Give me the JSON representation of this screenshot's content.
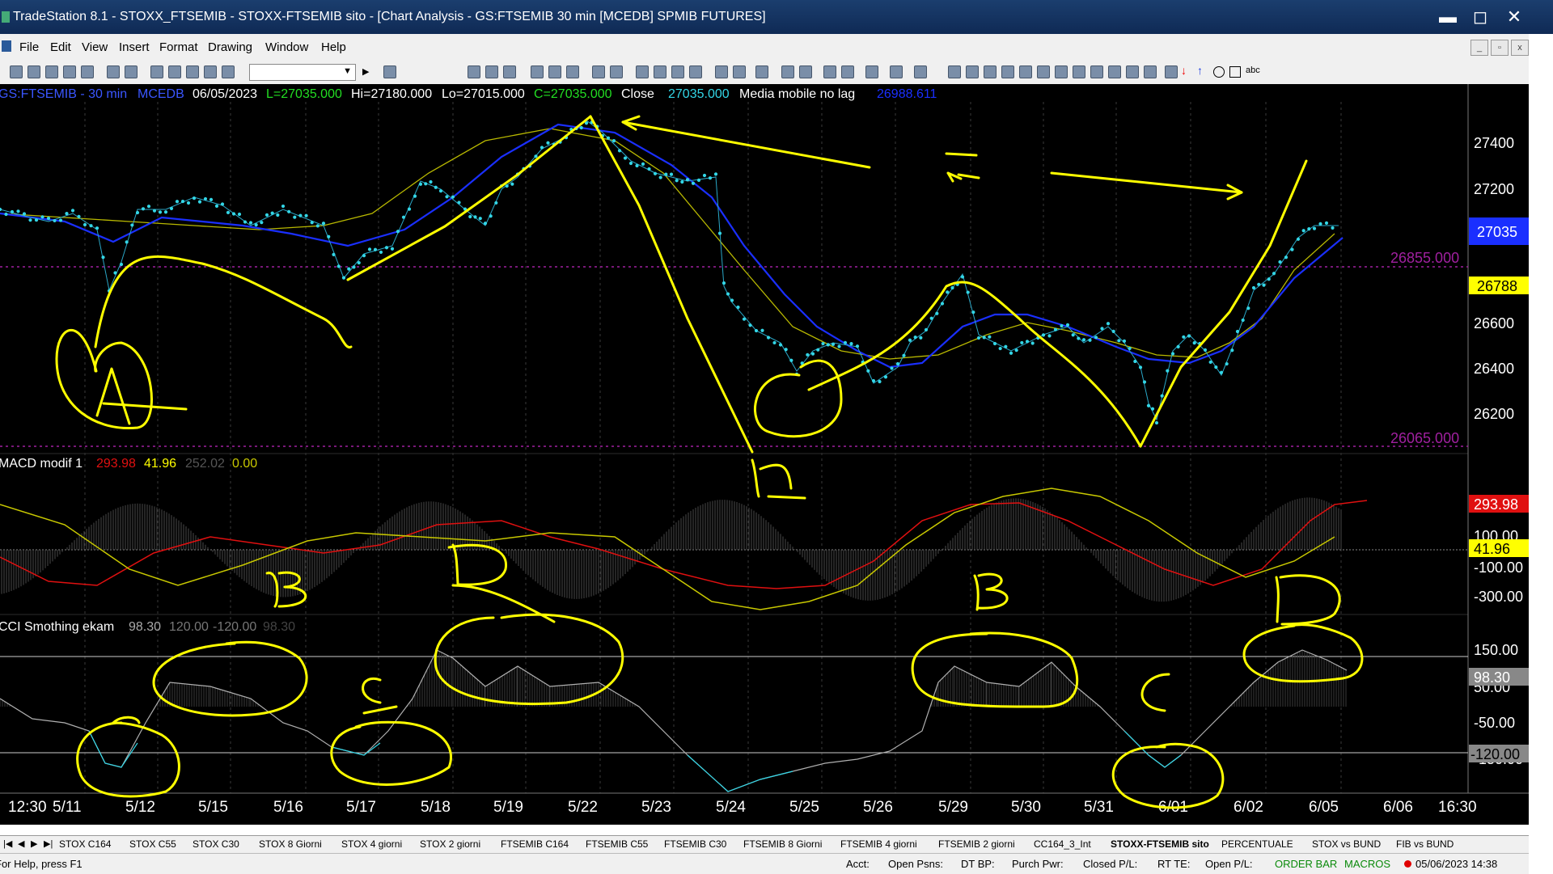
{
  "window": {
    "title": "TradeStation 8.1 - STOXX_FTSEMIB - STOXX-FTSEMIB sito - [Chart Analysis - GS:FTSEMIB  30 min  [MCEDB] SPMIB FUTURES]",
    "minimize": "▬",
    "maximize": "◻",
    "close": "✕"
  },
  "menu": {
    "items": [
      "File",
      "Edit",
      "View",
      "Insert",
      "Format",
      "Drawing",
      "Window",
      "Help"
    ],
    "mdi_minimize": "_",
    "mdi_restore": "▫",
    "mdi_close": "x"
  },
  "toolbar": {
    "symbol_value": ""
  },
  "chart": {
    "header": {
      "symbol": "GS:FTSEMIB - 30 min",
      "exchange": "MCEDB",
      "date": "06/05/2023",
      "low": "L=27035.000",
      "high": "Hi=27180.000",
      "lo": "Lo=27015.000",
      "close": "C=27035.000",
      "close_label": "Close",
      "close_value": "27035.000",
      "indicator": "Media mobile no lag",
      "indicator_value": "26988.611"
    },
    "price_axis": [
      "27400",
      "27200",
      "26600",
      "26400",
      "26200"
    ],
    "price_badges": {
      "last": "27035",
      "line1": "26855.000",
      "yellow": "26788",
      "line2": "26065.000"
    },
    "macd": {
      "label": "MACD modif 1",
      "v1": "293.98",
      "v2": "41.96",
      "v3": "252.02",
      "v4": "0.00",
      "axis": [
        "100.00",
        "-100.00",
        "-300.00"
      ],
      "badge_red": "293.98",
      "badge_yellow": "41.96"
    },
    "cci": {
      "label": "CCI Smothing ekam",
      "v1": "98.30",
      "v2": "120.00",
      "v3": "-120.00",
      "v4": "98.30",
      "axis": [
        "150.00",
        "50.00",
        "-50.00",
        "-150.00"
      ],
      "badge_value": "98.30",
      "badge_lower": "-120.00"
    },
    "time_axis": [
      "12:30",
      "5/11",
      "5/12",
      "5/15",
      "5/16",
      "5/17",
      "5/18",
      "5/19",
      "5/22",
      "5/23",
      "5/24",
      "5/25",
      "5/26",
      "5/29",
      "5/30",
      "5/31",
      "6/01",
      "6/02",
      "6/05",
      "6/06",
      "16:30"
    ],
    "annotations": {
      "A": "A",
      "B1": "B",
      "D1": "D",
      "C1": "C",
      "B2": "B",
      "C2": "C",
      "D2": "D",
      "eq": "="
    }
  },
  "tabs": [
    "STOX C164",
    "STOX C55",
    "STOX  C30",
    "STOX  8 Giorni",
    "STOX 4 giorni",
    "STOX  2 giorni",
    "FTSEMIB C164",
    "FTSEMIB C55",
    "FTSEMIB C30",
    "FTSEMIB  8 Giorni",
    "FTSEMIB  4 giorni",
    "FTSEMIB  2 giorni",
    "CC164_3_Int",
    "STOXX-FTSEMIB sito",
    "PERCENTUALE",
    "STOX vs BUND",
    "FIB vs BUND"
  ],
  "active_tab": "STOXX-FTSEMIB sito",
  "status": {
    "help": "For Help, press F1",
    "acct": "Acct:",
    "open_psns": "Open Psns:",
    "dt_bp": "DT BP:",
    "purch_pwr": "Purch Pwr:",
    "closed_pl": "Closed P/L:",
    "rt_te": "RT TE:",
    "open_pl": "Open P/L:",
    "order_bar": "ORDER BAR",
    "macros": "MACROS",
    "datetime": "05/06/2023 14:38"
  },
  "colors": {
    "price_dots": "#33d6e6",
    "ma_blue": "#1a2fff",
    "ma_yellow": "#c8c800",
    "annotation": "#ffff00",
    "macd_red": "#e01010",
    "dotted_magenta": "#a0209f"
  }
}
